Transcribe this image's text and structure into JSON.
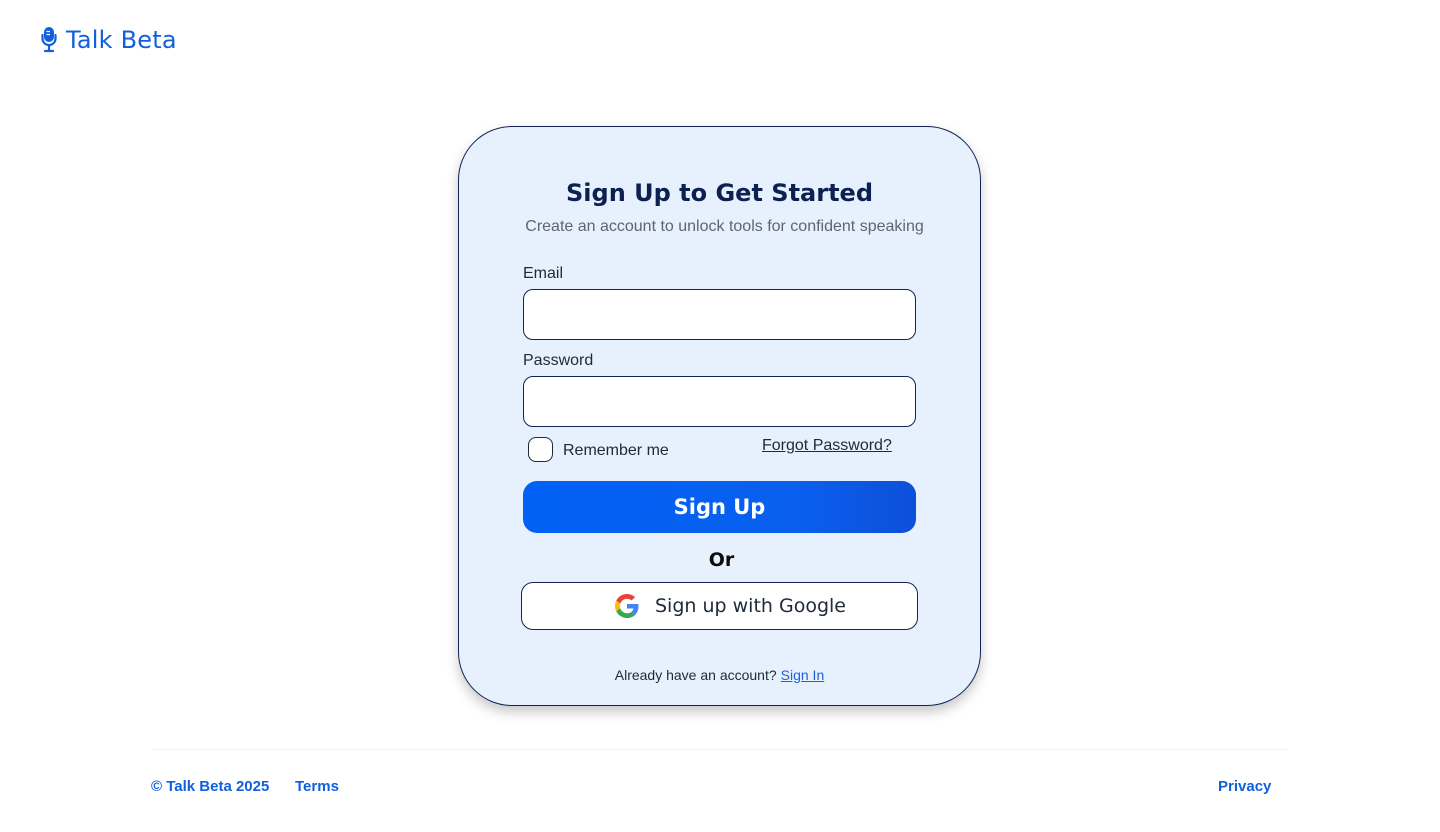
{
  "brand": {
    "name": "Talk Beta",
    "icon": "microphone-icon",
    "color": "#1060dd"
  },
  "form": {
    "title": "Sign Up to Get Started",
    "subtitle": "Create an account to unlock tools for confident speaking",
    "email_label": "Email",
    "email_value": "",
    "password_label": "Password",
    "password_value": "",
    "remember_label": "Remember me",
    "remember_checked": false,
    "forgot_label": "Forgot Password?",
    "submit_label": "Sign Up",
    "or_label": "Or",
    "google_label": "Sign up with Google",
    "google_icon": "google-icon",
    "already_text": "Already have an account?",
    "signin_label": "Sign In"
  },
  "footer": {
    "copyright": "© Talk Beta 2025",
    "terms": "Terms",
    "privacy": "Privacy"
  },
  "colors": {
    "primary": "#0061f5",
    "card_bg": "#e7f0fd",
    "card_border": "#12245a",
    "title": "#0d2150",
    "link": "#1a63d6"
  }
}
